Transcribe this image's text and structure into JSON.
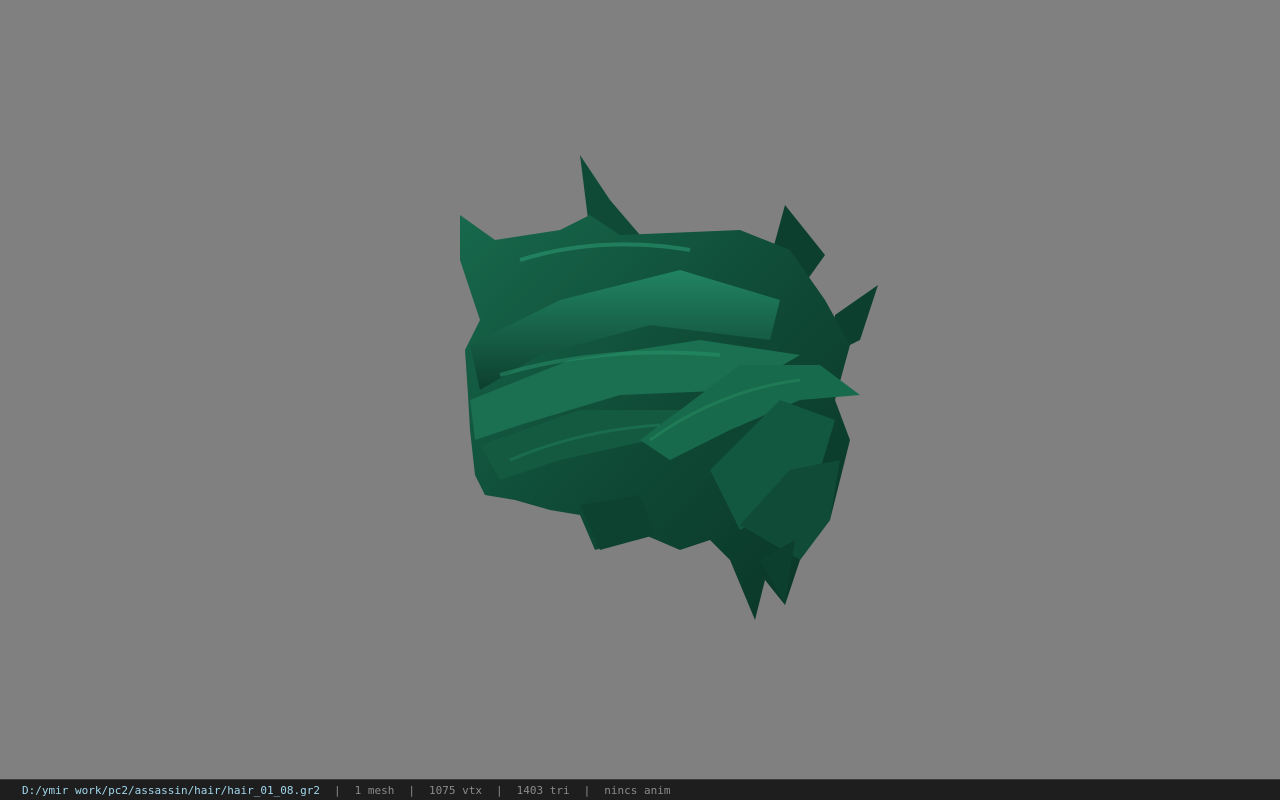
{
  "status": {
    "file_path": "D:/ymir work/pc2/assassin/hair/hair_01_08.gr2",
    "separator": "|",
    "mesh_count": "1 mesh",
    "vertex_count": "1075 vtx",
    "triangle_count": "1403 tri",
    "anim_status": "nincs anim"
  },
  "colors": {
    "background": "#808080",
    "hair_dark": "#0d3b2c",
    "hair_mid": "#145a43",
    "hair_light": "#1f7a5a",
    "skin": "#b08a74",
    "statusbar_bg": "#1e1e1e",
    "path_text": "#9fd4ea",
    "stat_text": "#8a8a8a"
  }
}
